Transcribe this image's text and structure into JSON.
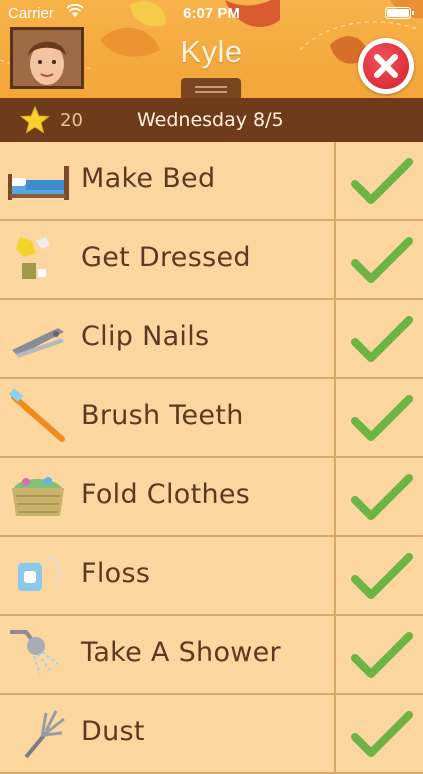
{
  "status_bar": {
    "carrier": "Carrier",
    "time": "6:07 PM"
  },
  "header": {
    "kid_name": "Kyle"
  },
  "info_bar": {
    "points": "20",
    "date": "Wednesday 8/5"
  },
  "colors": {
    "header_orange": "#f5ab40",
    "bar_brown": "#6e3c1b",
    "row_bg": "#fbd69f",
    "check_green": "#6cb443",
    "close_red": "#e0303a"
  },
  "chores": [
    {
      "label": "Make Bed",
      "icon": "bed-icon",
      "done": true
    },
    {
      "label": "Get Dressed",
      "icon": "clothes-icon",
      "done": true
    },
    {
      "label": "Clip Nails",
      "icon": "nail-clipper-icon",
      "done": true
    },
    {
      "label": "Brush Teeth",
      "icon": "toothbrush-icon",
      "done": true
    },
    {
      "label": "Fold Clothes",
      "icon": "laundry-basket-icon",
      "done": true
    },
    {
      "label": "Floss",
      "icon": "floss-icon",
      "done": true
    },
    {
      "label": "Take A Shower",
      "icon": "shower-icon",
      "done": true
    },
    {
      "label": "Dust",
      "icon": "duster-icon",
      "done": true
    }
  ]
}
